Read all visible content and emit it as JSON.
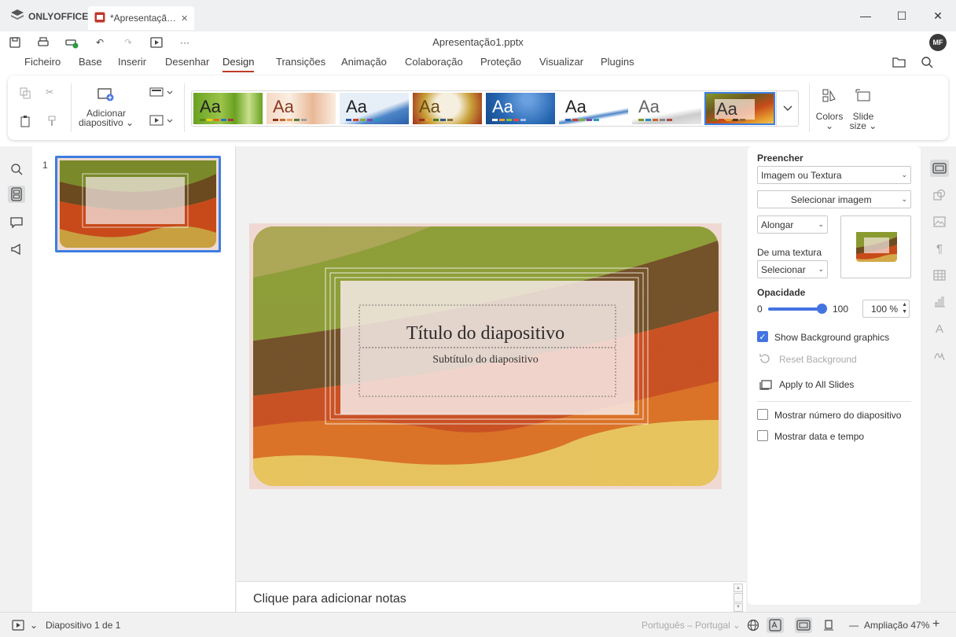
{
  "app": {
    "brand": "ONLYOFFICE",
    "tab_title": "*Apresentaçã…",
    "file_title": "Apresentação1.pptx",
    "user_initials": "MF"
  },
  "menu": {
    "tabs": [
      "Ficheiro",
      "Base",
      "Inserir",
      "Desenhar",
      "Design",
      "Transições",
      "Animação",
      "Colaboração",
      "Proteção",
      "Visualizar",
      "Plugins"
    ],
    "active": "Design"
  },
  "ribbon": {
    "add_slide_line1": "Adicionar",
    "add_slide_line2": "diapositivo",
    "themes": [
      {
        "name": "Aa",
        "colors": [
          "#6aa121",
          "#e9e9e9"
        ],
        "selected": false
      },
      {
        "name": "Aa",
        "colors": [
          "#f0c8b0",
          "#fff2e8"
        ],
        "selected": false
      },
      {
        "name": "Aa",
        "colors": [
          "#4d86c8",
          "#c9dcf0"
        ],
        "selected": false
      },
      {
        "name": "Aa",
        "colors": [
          "#c9a23a",
          "#f5efe0"
        ],
        "selected": false
      },
      {
        "name": "Aa",
        "colors": [
          "#2565b0",
          "#4a8ad6"
        ],
        "selected": false
      },
      {
        "name": "Aa",
        "colors": [
          "#ffffff",
          "#4d86c8"
        ],
        "selected": false
      },
      {
        "name": "Aa",
        "colors": [
          "#ffffff",
          "#cccccc"
        ],
        "selected": false
      },
      {
        "name": "Aa",
        "colors": [
          "#8a9a2a",
          "#c64a1a"
        ],
        "selected": true
      }
    ],
    "colors_label": "Colors",
    "slide_size_line1": "Slide",
    "slide_size_line2": "size"
  },
  "thumbnails": {
    "number": "1"
  },
  "slide": {
    "title": "Título do diapositivo",
    "subtitle": "Subtítulo do diapositivo"
  },
  "notes": {
    "placeholder": "Clique para adicionar notas"
  },
  "panel": {
    "fill_label": "Preencher",
    "fill_type": "Imagem ou Textura",
    "select_image": "Selecionar imagem",
    "stretch": "Alongar",
    "texture_label": "De uma textura",
    "texture_select": "Selecionar",
    "opacity_label": "Opacidade",
    "opacity_min": "0",
    "opacity_max": "100",
    "opacity_value": "100 %",
    "opacity_level": 1.0,
    "show_bg_graphics": "Show Background graphics",
    "reset_bg": "Reset Background",
    "apply_all": "Apply to All Slides",
    "show_slide_number": "Mostrar número do diapositivo",
    "show_date_time": "Mostrar data e tempo"
  },
  "status": {
    "slide_counter": "Diapositivo 1 de 1",
    "language": "Português – Portugal",
    "zoom": "Ampliação 47%"
  }
}
